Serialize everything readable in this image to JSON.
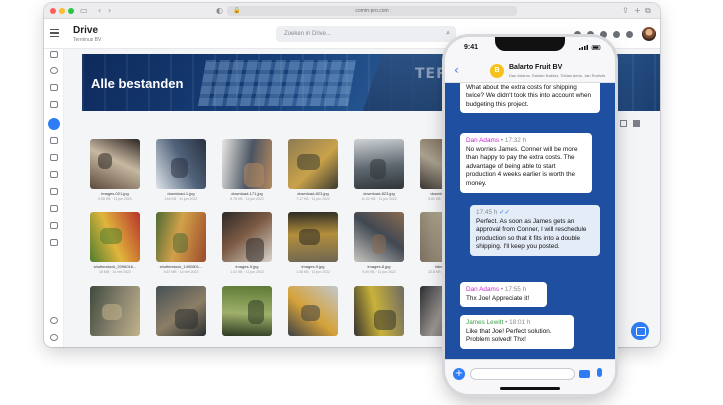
{
  "browser": {
    "url": "comm-pro.com",
    "reader_icon": "reader-icon",
    "lock_icon": "lock-icon"
  },
  "app": {
    "title": "Drive",
    "subtitle": "Terminus BV",
    "search_placeholder": "Zoeken in Drive..."
  },
  "hero": {
    "title": "Alle bestanden",
    "sign": "TERMIN"
  },
  "files": [
    {
      "name": "images-021.jpg",
      "meta": "9.08 KB · 11 jun 2022",
      "palette": [
        "#5b4a3a",
        "#c7b8a2",
        "#2c2420"
      ]
    },
    {
      "name": "download-1.jpg",
      "meta": "144 KB · 11 jun 2022",
      "palette": [
        "#dfe4ea",
        "#50627a",
        "#2a3140"
      ]
    },
    {
      "name": "download-171.jpg",
      "meta": "5.78 KB · 11 jun 2022",
      "palette": [
        "#e8e6e2",
        "#4b5563",
        "#b68a5e"
      ]
    },
    {
      "name": "download-823.jpg",
      "meta": "7.17 KB · 11 jun 2022",
      "palette": [
        "#8d7b55",
        "#c9a24a",
        "#3a3a30"
      ]
    },
    {
      "name": "download-823.jpg",
      "meta": "11.02 KB · 11 jun 2022",
      "palette": [
        "#cfd3d6",
        "#5f6870",
        "#2f3438"
      ]
    },
    {
      "name": "download-23.jpg",
      "meta": "5.61 KB · 11 jun 2022",
      "palette": [
        "#6e5a48",
        "#a9a18e",
        "#3a3430"
      ]
    },
    {
      "name": "shutterstock_2096016...",
      "meta": "15 MB · 14 mrt 2022",
      "palette": [
        "#b8332a",
        "#e0b53c",
        "#4f7d2e"
      ]
    },
    {
      "name": "shutterstock_1490801...",
      "meta": "4.67 MB · 14 mrt 2022",
      "palette": [
        "#9c4a2a",
        "#d2a14a",
        "#4e6b34"
      ]
    },
    {
      "name": "images-9.jpg",
      "meta": "1.02 KB · 11 jun 2022",
      "palette": [
        "#d9d4cc",
        "#7c5a44",
        "#2d2a28"
      ]
    },
    {
      "name": "images-9.jpg",
      "meta": "1.08 KB · 11 jun 2022",
      "palette": [
        "#6f6652",
        "#b38f3c",
        "#2c2a24"
      ]
    },
    {
      "name": "images-8.jpg",
      "meta": "9.49 KB · 11 jun 2022",
      "palette": [
        "#c9c6c0",
        "#404852",
        "#8b6c52"
      ]
    },
    {
      "name": "fabrikken...",
      "meta": "22.8 KB · 11 jun 2022",
      "palette": [
        "#7a6e5e",
        "#b0a890",
        "#3a3530"
      ]
    },
    {
      "name": "",
      "meta": "",
      "palette": [
        "#3f4a3c",
        "#8a8470",
        "#c2b48a"
      ]
    },
    {
      "name": "",
      "meta": "",
      "palette": [
        "#455054",
        "#8c7e66",
        "#2a2e30"
      ]
    },
    {
      "name": "",
      "meta": "",
      "palette": [
        "#5c7a36",
        "#9fb06a",
        "#2e3a22"
      ]
    },
    {
      "name": "",
      "meta": "",
      "palette": [
        "#c2c7cc",
        "#d5a23a",
        "#3c4046"
      ]
    },
    {
      "name": "",
      "meta": "",
      "palette": [
        "#6c6a64",
        "#c9b23a",
        "#36342e"
      ]
    },
    {
      "name": "",
      "meta": "",
      "palette": [
        "#4a4a4e",
        "#9a9692",
        "#2c2c30"
      ]
    }
  ],
  "chat": {
    "contact": "Balarto Fruit BV",
    "members": "Dan Adams, Sander Bakker, Tobias Aeris, Jan Roelofs",
    "logo_letter": "B",
    "time": "9:41",
    "messages": [
      {
        "author": "",
        "time": "",
        "text": "double. I will check and let you guys know. What about the extra costs for shipping twice? We didn't took this into account when budgeting this project.",
        "mine": false
      },
      {
        "author": "Dan Adams",
        "time": "• 17:32 h",
        "text": "No worries James. Conner will be more than happy to pay the extra costs. The advantage of being able to start production 4 weeks earlier is worth the money.",
        "mine": false
      },
      {
        "author": "",
        "time": "17:45 h",
        "text": "Perfect. As soon as James gets an approval from Conner, I will reschedule production so that it fits into a double shipping. I'll keep you posted.",
        "mine": true
      },
      {
        "author": "Dan Adams",
        "time": "• 17:55 h",
        "text": "Thx Joe! Appreciate it!",
        "mine": false
      },
      {
        "author": "James Lewitt",
        "time": "• 18:01 h",
        "text": "Like that Joe! Perfect solution. Problem solved! Thx!",
        "mine": false
      }
    ]
  },
  "colors": {
    "accent": "#2f7df6",
    "chat_bg": "#1e4fa0",
    "dan": "#c22bd0",
    "james": "#3aa24a"
  }
}
